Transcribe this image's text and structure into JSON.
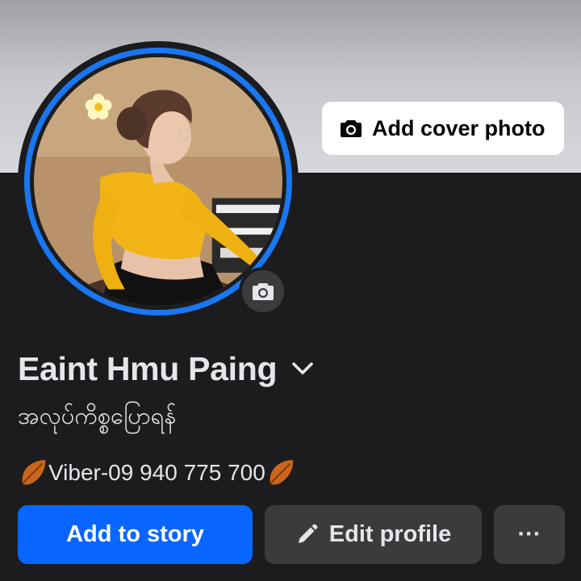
{
  "cover": {
    "add_cover_label": "Add cover photo",
    "icon": "camera-icon"
  },
  "profile": {
    "name": "Eaint Hmu Paing",
    "bio": "အလုပ်ကိစ္စပြောရန်",
    "viber_line": "Viber-09 940 775 700",
    "name_dropdown_icon": "chevron-down-icon",
    "avatar_icon": "camera-icon",
    "decor_icon": "leaf-icon"
  },
  "actions": {
    "add_story_label": "Add to story",
    "edit_profile_label": "Edit profile",
    "more_label": "···"
  },
  "colors": {
    "background": "#1c1c1e",
    "accent_blue": "#0866ff",
    "ring_blue": "#1877f2",
    "secondary_button": "#3a3b3c"
  }
}
